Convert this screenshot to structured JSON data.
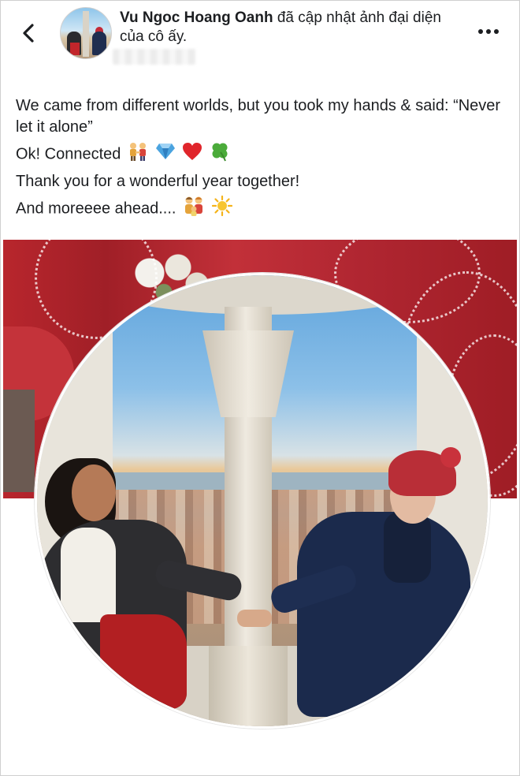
{
  "post": {
    "author_name": "Vu Ngoc Hoang Oanh",
    "action_text": " đã cập nhật ảnh đại diện của cô ấy."
  },
  "caption": {
    "line1": "We came from different worlds, but you took my hands & said: “Never let it alone”",
    "line2": "Ok! Connected",
    "line3": "Thank you for a wonderful year together!",
    "line4": "And moreeee ahead...."
  },
  "icons": {
    "back": "chevron-left-icon",
    "more": "more-options-icon",
    "emojis": [
      "couple-holding-hands-icon",
      "gem-icon",
      "red-heart-icon",
      "four-leaf-clover-icon",
      "family-icon",
      "sun-icon"
    ]
  },
  "colors": {
    "text": "#1c1e21",
    "heart": "#e0252b",
    "gem": "#4aa3df",
    "clover": "#4bab3a",
    "sun": "#f5b31a"
  }
}
